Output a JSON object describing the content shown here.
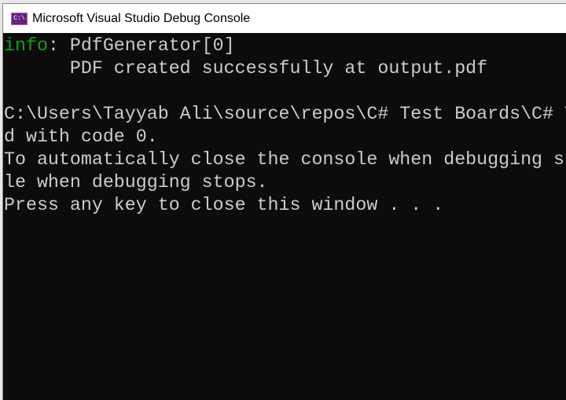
{
  "window": {
    "title": "Microsoft Visual Studio Debug Console",
    "icon": "console-app-icon",
    "icon_text": "C:\\"
  },
  "console": {
    "info_prefix": "info",
    "lines": [
      ": PdfGenerator[0]",
      "      PDF created successfully at output.pdf",
      "",
      "C:\\Users\\Tayyab Ali\\source\\repos\\C# Test Boards\\C# T",
      "d with code 0.",
      "To automatically close the console when debugging st",
      "le when debugging stops.",
      "Press any key to close this window . . ."
    ],
    "colors": {
      "background": "#0c0c0c",
      "text": "#cccccc",
      "info": "#13a10e"
    }
  }
}
